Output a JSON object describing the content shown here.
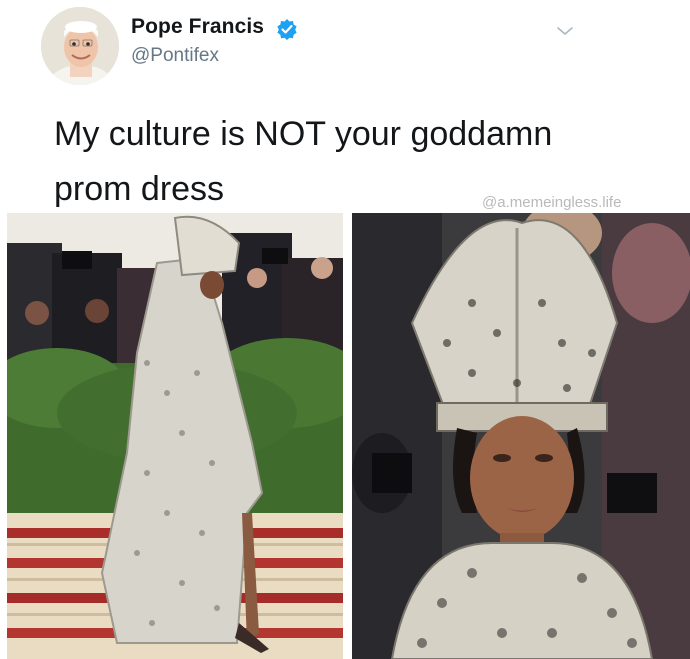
{
  "tweet": {
    "display_name": "Pope Francis",
    "handle": "@Pontifex",
    "text_line1": "My culture is NOT your goddamn",
    "text_line2": "prom dress",
    "verified": true
  },
  "watermark": "@a.memeingless.life",
  "icons": {
    "verified": "verified-badge-icon",
    "menu": "chevron-down-icon"
  },
  "colors": {
    "verified_blue": "#1da1f2",
    "name_text": "#14171a",
    "handle_text": "#657786"
  }
}
